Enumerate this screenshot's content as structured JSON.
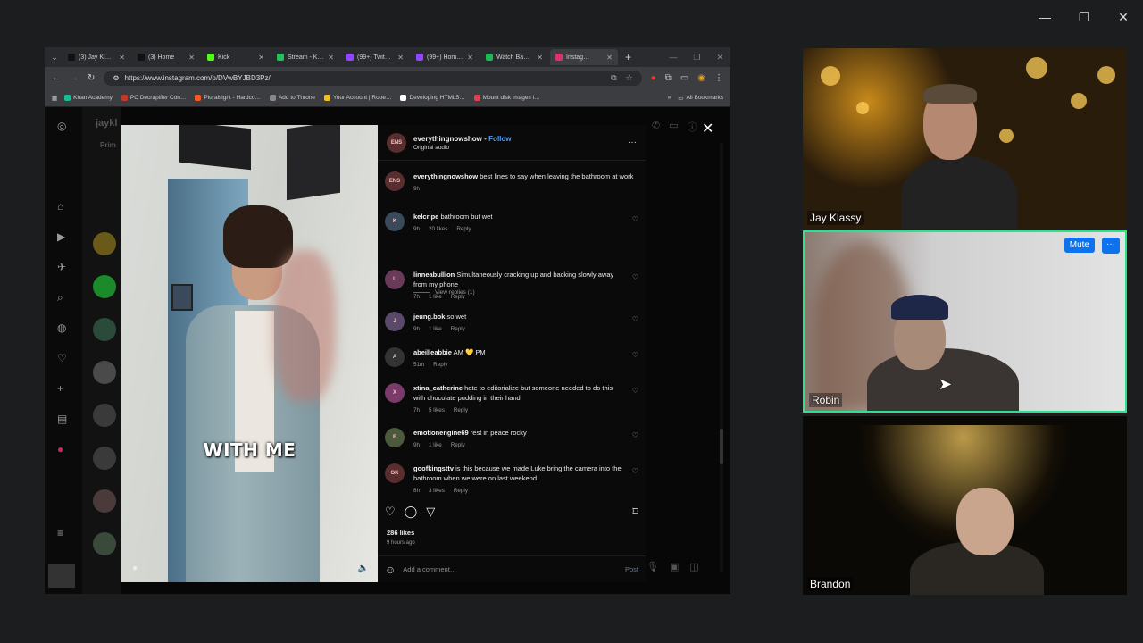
{
  "window_controls": {
    "minimize": "—",
    "maximize": "❐",
    "close": "✕"
  },
  "browser": {
    "tabs": [
      {
        "label": "(3) Jay Kl…",
        "color": "#111111"
      },
      {
        "label": "(3) Home",
        "color": "#111111"
      },
      {
        "label": "Kick",
        "color": "#53fc18"
      },
      {
        "label": "Stream - K…",
        "color": "#21c25e"
      },
      {
        "label": "(99+) Twit…",
        "color": "#9146ff"
      },
      {
        "label": "(99+) Hom…",
        "color": "#9146ff"
      },
      {
        "label": "Watch Ba…",
        "color": "#1db954"
      },
      {
        "label": "Instag…",
        "color": "#e1306c"
      }
    ],
    "url": "https://www.instagram.com/p/DVwBYJBD3Pz/",
    "bookmarks": [
      {
        "label": "Khan Academy",
        "color": "#14bf96"
      },
      {
        "label": "PC Decrapifier Con…",
        "color": "#c0392b"
      },
      {
        "label": "Pluralsight - Hardco…",
        "color": "#f15b2a"
      },
      {
        "label": "Add to Throne",
        "color": "#888888"
      },
      {
        "label": "Your Account | Robe…",
        "color": "#f0c020"
      },
      {
        "label": "Developing HTML5…",
        "color": "#ffffff"
      },
      {
        "label": "Mount disk images i…",
        "color": "#e04050"
      }
    ],
    "all_bookmarks": "All Bookmarks"
  },
  "instagram": {
    "dm_title": "jaykl",
    "primary_tab": "Prim",
    "post_author": "everythingnowshow",
    "follow": "Follow",
    "audio": "Original audio",
    "video_caption": "WITH ME",
    "comments": [
      {
        "user": "everythingnowshow",
        "text": "best lines to say when leaving the bathroom at work",
        "time": "9h",
        "likes": "",
        "color": "#5a2e2e",
        "initials": "ENS"
      },
      {
        "user": "kelcripe",
        "text": "bathroom but wet",
        "time": "9h",
        "likes": "20 likes",
        "color": "#3a4a5a",
        "initials": "K"
      },
      {
        "user": "linneabullion",
        "text": "Simultaneously cracking up and backing slowly away from my phone",
        "time": "7h",
        "likes": "1 like",
        "color": "#6a3a5a",
        "initials": "L"
      },
      {
        "user": "jeung.bok",
        "text": "so wet",
        "time": "9h",
        "likes": "1 like",
        "color": "#5a4a6a",
        "initials": "J"
      },
      {
        "user": "abeilleabbie",
        "text": "AM 💛 PM",
        "time": "51m",
        "likes": "",
        "color": "#333333",
        "initials": "A"
      },
      {
        "user": "xtina_catherine",
        "text": "hate to editorialize but someone needed to do this with chocolate pudding in their hand.",
        "time": "7h",
        "likes": "5 likes",
        "color": "#7a3a6a",
        "initials": "X"
      },
      {
        "user": "emotionengine69",
        "text": "rest in peace rocky",
        "time": "9h",
        "likes": "1 like",
        "color": "#4a5a3a",
        "initials": "E"
      },
      {
        "user": "goofkingsttv",
        "text": "is this because we made Luke bring the camera into the bathroom when we were on last weekend",
        "time": "8h",
        "likes": "3 likes",
        "color": "#5a2e2e",
        "initials": "GK"
      }
    ],
    "reply_label": "Reply",
    "view_replies": "View replies (1)",
    "likes": "286 likes",
    "posted": "9 hours ago",
    "add_comment": "Add a comment…",
    "post_btn": "Post"
  },
  "participants": [
    {
      "name": "Jay Klassy"
    },
    {
      "name": "Robin",
      "mute": "Mute",
      "more": "···"
    },
    {
      "name": "Brandon"
    }
  ]
}
